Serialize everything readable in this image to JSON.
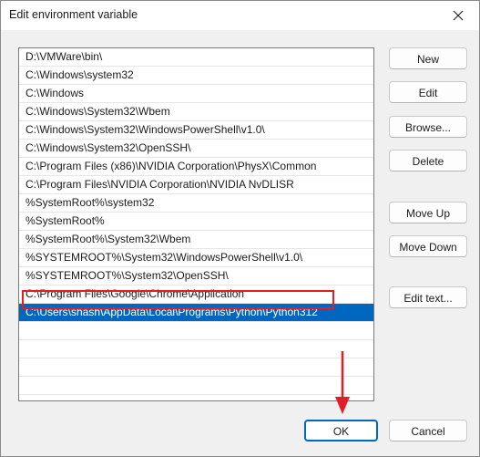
{
  "window": {
    "title": "Edit environment variable"
  },
  "icons": {
    "close": "close-icon",
    "annotation_arrow": "down-arrow-icon"
  },
  "colors": {
    "selection": "#0067c0",
    "highlight": "#e01e23",
    "arrow": "#e01e23"
  },
  "list": {
    "items": [
      "D:\\VMWare\\bin\\",
      "C:\\Windows\\system32",
      "C:\\Windows",
      "C:\\Windows\\System32\\Wbem",
      "C:\\Windows\\System32\\WindowsPowerShell\\v1.0\\",
      "C:\\Windows\\System32\\OpenSSH\\",
      "C:\\Program Files (x86)\\NVIDIA Corporation\\PhysX\\Common",
      "C:\\Program Files\\NVIDIA Corporation\\NVIDIA NvDLISR",
      "%SystemRoot%\\system32",
      "%SystemRoot%",
      "%SystemRoot%\\System32\\Wbem",
      "%SYSTEMROOT%\\System32\\WindowsPowerShell\\v1.0\\",
      "%SYSTEMROOT%\\System32\\OpenSSH\\",
      "C:\\Program Files\\Google\\Chrome\\Application",
      "C:\\Users\\shash\\AppData\\Local\\Programs\\Python\\Python312"
    ],
    "selected_index": 14
  },
  "buttons": {
    "new": "New",
    "edit": "Edit",
    "browse": "Browse...",
    "delete": "Delete",
    "move_up": "Move Up",
    "move_down": "Move Down",
    "edit_text": "Edit text...",
    "ok": "OK",
    "cancel": "Cancel"
  }
}
